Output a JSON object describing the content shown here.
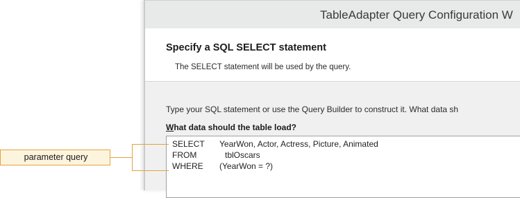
{
  "window": {
    "title": "TableAdapter Query Configuration W"
  },
  "header": {
    "heading": "Specify a SQL SELECT statement",
    "subheading": "The SELECT statement will be used by the query."
  },
  "body": {
    "instruction": "Type your SQL statement or use the Query Builder to construct it. What data sh",
    "prompt_accel": "W",
    "prompt_rest": "hat data should the table load?",
    "sql": [
      {
        "keyword": "SELECT",
        "clause": "YearWon, Actor, Actress, Picture, Animated"
      },
      {
        "keyword": "FROM",
        "clause": "tblOscars"
      },
      {
        "keyword": "WHERE",
        "clause": "(YearWon = ?)"
      }
    ]
  },
  "callout": {
    "label": "parameter query",
    "line_color": "#e3a23a",
    "fill_color": "#fdf4de"
  }
}
